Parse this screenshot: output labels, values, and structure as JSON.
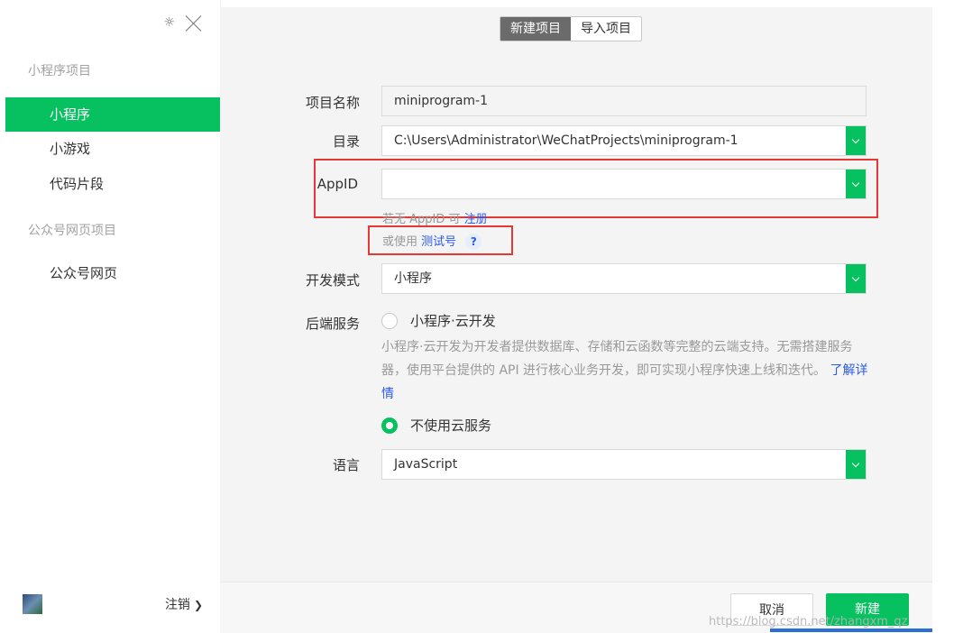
{
  "sidebar": {
    "sections": [
      {
        "title": "小程序项目",
        "items": [
          {
            "label": "小程序",
            "active": true
          },
          {
            "label": "小游戏",
            "active": false
          },
          {
            "label": "代码片段",
            "active": false
          }
        ]
      },
      {
        "title": "公众号网页项目",
        "items": [
          {
            "label": "公众号网页",
            "active": false
          }
        ]
      }
    ],
    "logout_label": "注销",
    "icons": {
      "settings": "gear-icon",
      "close": "close-icon",
      "logout_chevron": "chevron-right-icon",
      "avatar": "user-avatar"
    }
  },
  "header": {
    "tabs": [
      {
        "label": "新建项目",
        "active": true
      },
      {
        "label": "导入项目",
        "active": false
      }
    ]
  },
  "form": {
    "project_name": {
      "label": "项目名称",
      "value": "miniprogram-1"
    },
    "directory": {
      "label": "目录",
      "value": "C:\\Users\\Administrator\\WeChatProjects\\miniprogram-1"
    },
    "appid": {
      "label": "AppID",
      "value": "",
      "hint_prefix": "若无 AppID 可",
      "hint_link": "注册",
      "test_prefix": "或使用",
      "test_link": "测试号",
      "help": "?"
    },
    "dev_mode": {
      "label": "开发模式",
      "value": "小程序"
    },
    "backend": {
      "label": "后端服务",
      "cloud_option": "小程序·云开发",
      "description": "小程序·云开发为开发者提供数据库、存储和云函数等完整的云端支持。无需搭建服务器，使用平台提供的 API 进行核心业务开发，即可实现小程序快速上线和迭代。",
      "learn_more": "了解详情",
      "no_cloud_option": "不使用云服务",
      "selected": "no_cloud"
    },
    "language": {
      "label": "语言",
      "value": "JavaScript"
    }
  },
  "footer": {
    "cancel_label": "取消",
    "create_label": "新建",
    "watermark": "https://blog.csdn.net/zhangxm_qz"
  },
  "colors": {
    "accent": "#07c160",
    "link": "#2b5aed",
    "highlight": "#e53935",
    "segment_active": "#6b6b6b"
  }
}
